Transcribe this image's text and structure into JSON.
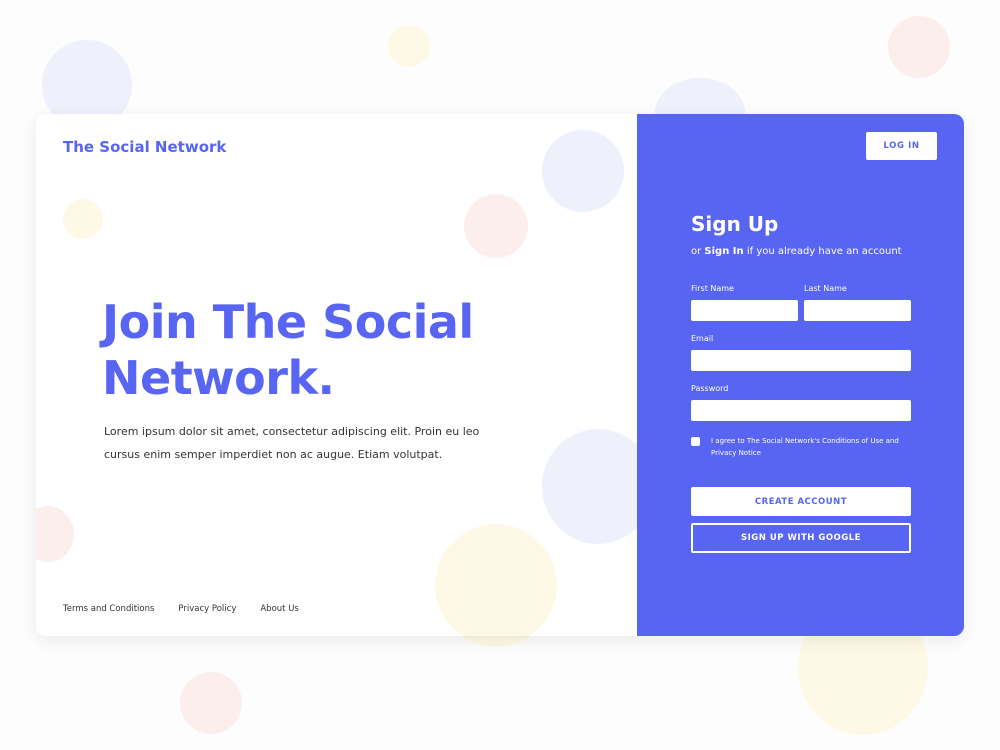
{
  "brand": {
    "name": "The Social Network",
    "color": "#5865f2"
  },
  "hero": {
    "title": "Join The Social Network.",
    "body": "Lorem ipsum dolor sit amet, consectetur adipiscing elit. Proin eu leo cursus enim semper imperdiet non ac augue. Etiam volutpat."
  },
  "footer": {
    "links": [
      "Terms and Conditions",
      "Privacy Policy",
      "About Us"
    ]
  },
  "header": {
    "login_label": "LOG IN"
  },
  "signup": {
    "title": "Sign Up",
    "sub_prefix": "or",
    "sub_link": "Sign In",
    "sub_suffix": "if you already have an account",
    "first_name_label": "First Name",
    "first_name_value": "",
    "last_name_label": "Last Name",
    "last_name_value": "",
    "email_label": "Email",
    "email_value": "",
    "password_label": "Password",
    "password_value": "",
    "agree_text": "I agree to The Social Network's Conditions of Use and Privacy Notice",
    "agree_checked": false,
    "create_label": "CREATE ACCOUNT",
    "google_label": "SIGN UP WITH GOOGLE"
  },
  "colors": {
    "accent": "#5865f2",
    "bubble_blue": "#eef0fc",
    "bubble_red": "#fdeeee",
    "bubble_yellow": "#fdf9e6"
  },
  "icons": [
    "speech-bubble-icon"
  ]
}
